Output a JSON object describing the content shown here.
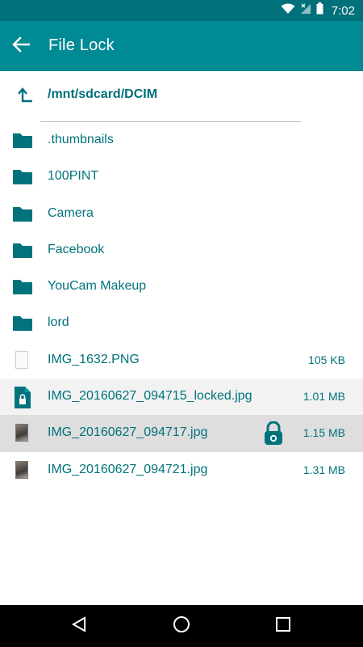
{
  "status": {
    "time": "7:02"
  },
  "app_bar": {
    "title": "File Lock"
  },
  "path": {
    "current": "/mnt/sdcard/DCIM"
  },
  "files": [
    {
      "name": ".thumbnails",
      "size": "",
      "kind": "folder"
    },
    {
      "name": "100PINT",
      "size": "",
      "kind": "folder"
    },
    {
      "name": "Camera",
      "size": "",
      "kind": "folder"
    },
    {
      "name": "Facebook",
      "size": "",
      "kind": "folder"
    },
    {
      "name": "YouCam Makeup",
      "size": "",
      "kind": "folder"
    },
    {
      "name": "lord",
      "size": "",
      "kind": "folder"
    },
    {
      "name": "IMG_1632.PNG",
      "size": "105 KB",
      "kind": "image"
    },
    {
      "name": "IMG_20160627_094715_locked.jpg",
      "size": "1.01 MB",
      "kind": "locked-file"
    },
    {
      "name": "IMG_20160627_094717.jpg",
      "size": "1.15 MB",
      "kind": "image",
      "lock_shown": true
    },
    {
      "name": "IMG_20160627_094721.jpg",
      "size": "1.31 MB",
      "kind": "image"
    }
  ],
  "colors": {
    "status_bar": "#00707a",
    "app_bar": "#008a94",
    "accent": "#00737c"
  }
}
